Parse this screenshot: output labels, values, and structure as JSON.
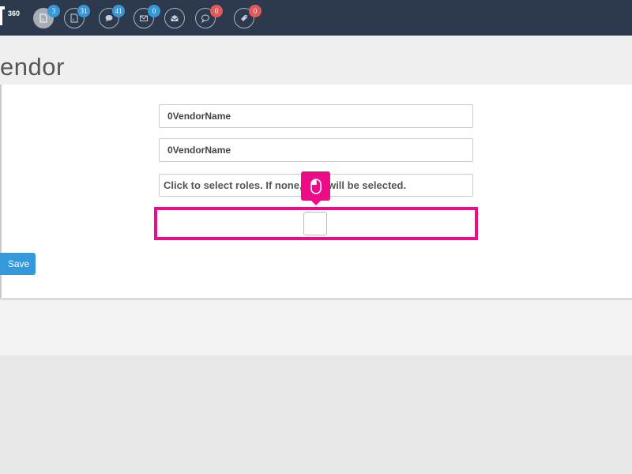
{
  "header": {
    "logo_number": "360",
    "nav": [
      {
        "icon": "document-icon",
        "badge": "3",
        "badge_color": "#3498db",
        "active": true
      },
      {
        "icon": "document-icon",
        "badge": "31",
        "badge_color": "#3498db"
      },
      {
        "icon": "chat-icon",
        "badge": "41",
        "badge_color": "#3498db"
      },
      {
        "icon": "mail-icon",
        "badge": "0",
        "badge_color": "#3498db"
      },
      {
        "icon": "mail-open-icon",
        "badge": "",
        "badge_color": ""
      },
      {
        "icon": "comment-icon",
        "badge": "0",
        "badge_color": "#e05a5a"
      },
      {
        "icon": "tag-icon",
        "badge": "0",
        "badge_color": "#e05a5a"
      }
    ]
  },
  "page": {
    "title": "endor"
  },
  "form": {
    "field1_value": "0VendorName",
    "field2_value": "0VendorName",
    "roles_text": "Click to select roles. If none, a      es will be selected.",
    "save_label": "Save"
  },
  "colors": {
    "topbar": "#2d3a4d",
    "accent": "#3498db",
    "highlight": "#ee0b88",
    "badge_red": "#e05a5a"
  }
}
